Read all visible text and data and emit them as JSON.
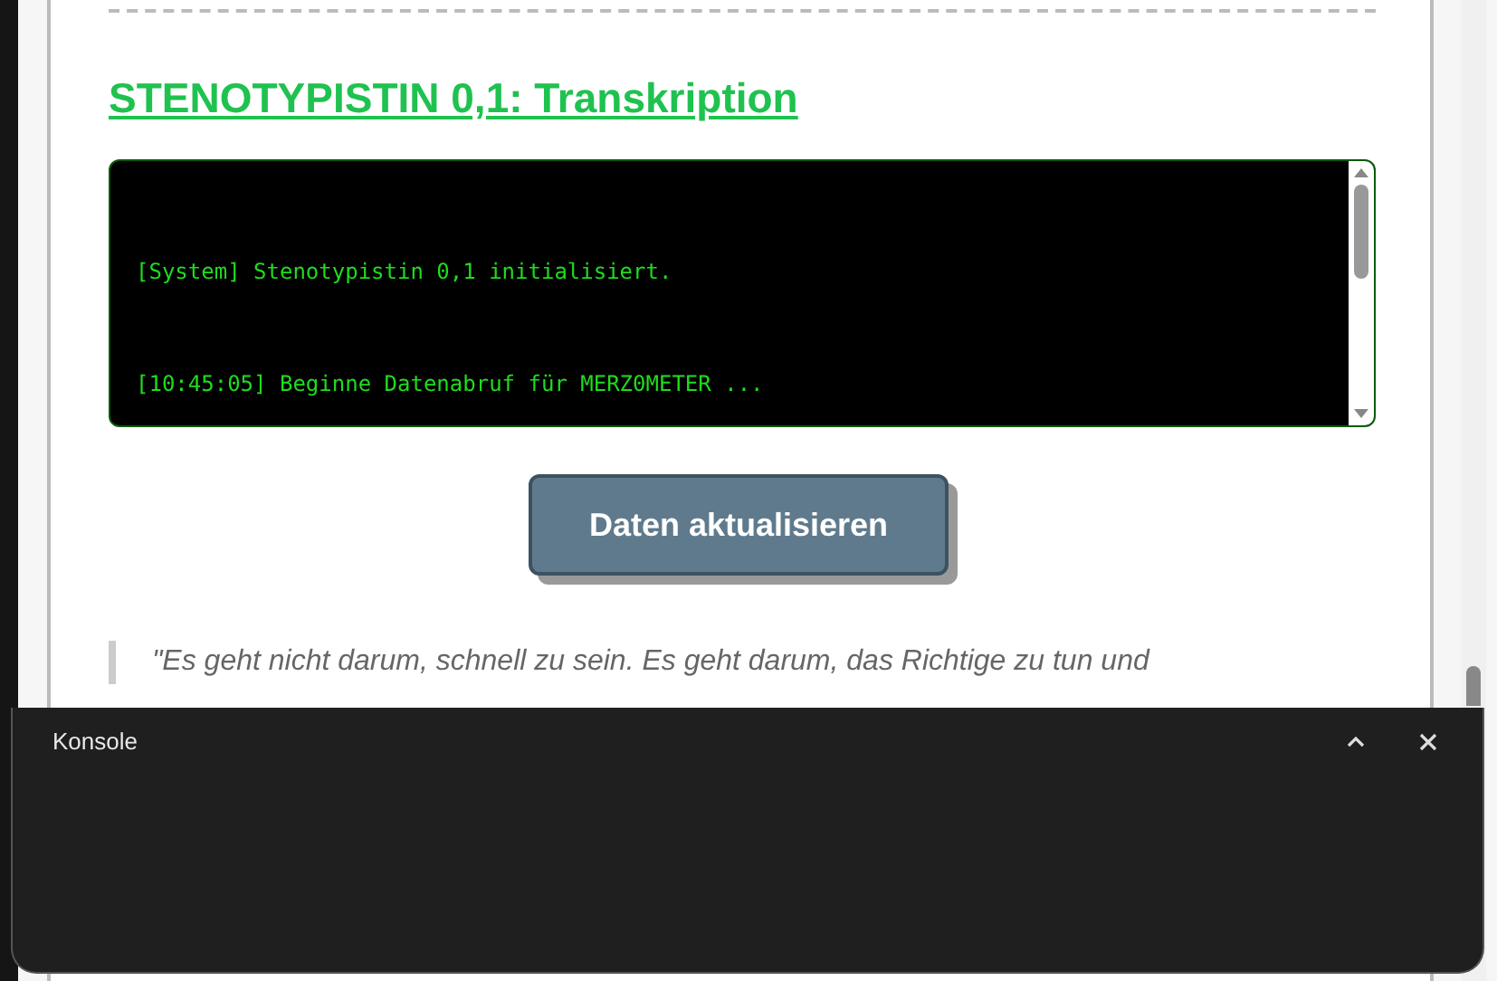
{
  "section": {
    "title": "STENOTYPISTIN 0,1: Transkription"
  },
  "terminal": {
    "lines": [
      {
        "text": "[System] Stenotypistin 0,1 initialisiert."
      },
      {
        "text": "[10:45:05] Beginne Datenabruf für MERZ0METER ..."
      }
    ]
  },
  "refresh_button": {
    "label": "Daten aktualisieren"
  },
  "quote": {
    "text": "\"Es geht nicht darum, schnell zu sein. Es geht darum, das Richtige zu tun und"
  },
  "console": {
    "title": "Konsole",
    "expanded": false
  }
}
